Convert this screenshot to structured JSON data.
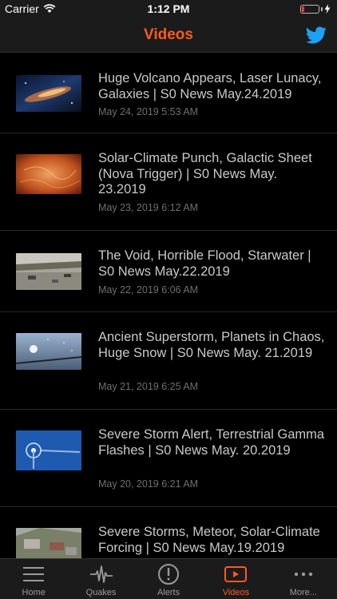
{
  "status_bar": {
    "carrier": "Carrier",
    "time": "1:12 PM",
    "battery_level": 0.15,
    "battery_color": "#ff3b30"
  },
  "nav": {
    "title": "Videos",
    "right_icon": "twitter-icon",
    "accent": "#ff5a1f"
  },
  "videos": [
    {
      "title": "Huge Volcano Appears, Laser Lunacy, Galaxies | S0 News May.24.2019",
      "date": "May 24, 2019 5:53 AM",
      "thumb": "galaxy-thumbnail"
    },
    {
      "title": "Solar-Climate Punch, Galactic Sheet (Nova Trigger) | S0 News May. 23.2019",
      "date": "May 23, 2019 6:12 AM",
      "thumb": "sun-surface-thumbnail"
    },
    {
      "title": "The Void, Horrible Flood, Starwater | S0 News May.22.2019",
      "date": "May 22, 2019 6:06 AM",
      "thumb": "flood-thumbnail"
    },
    {
      "title": "Ancient Superstorm, Planets in Chaos, Huge Snow | S0 News May. 21.2019",
      "date": "May 21, 2019 6:25 AM",
      "thumb": "snowstorm-thumbnail"
    },
    {
      "title": "Severe Storm Alert, Terrestrial Gamma Flashes | S0 News May. 20.2019",
      "date": "May 20, 2019 6:21 AM",
      "thumb": "coronagraph-thumbnail"
    },
    {
      "title": "Severe Storms, Meteor, Solar-Climate Forcing | S0 News May.19.2019",
      "date": "",
      "thumb": "storm-damage-thumbnail"
    }
  ],
  "tabs": [
    {
      "label": "Home",
      "icon": "menu-icon",
      "active": false
    },
    {
      "label": "Quakes",
      "icon": "seismograph-icon",
      "active": false
    },
    {
      "label": "Alerts",
      "icon": "alert-icon",
      "active": false
    },
    {
      "label": "Videos",
      "icon": "video-play-icon",
      "active": true
    },
    {
      "label": "More...",
      "icon": "more-dots-icon",
      "active": false
    }
  ]
}
